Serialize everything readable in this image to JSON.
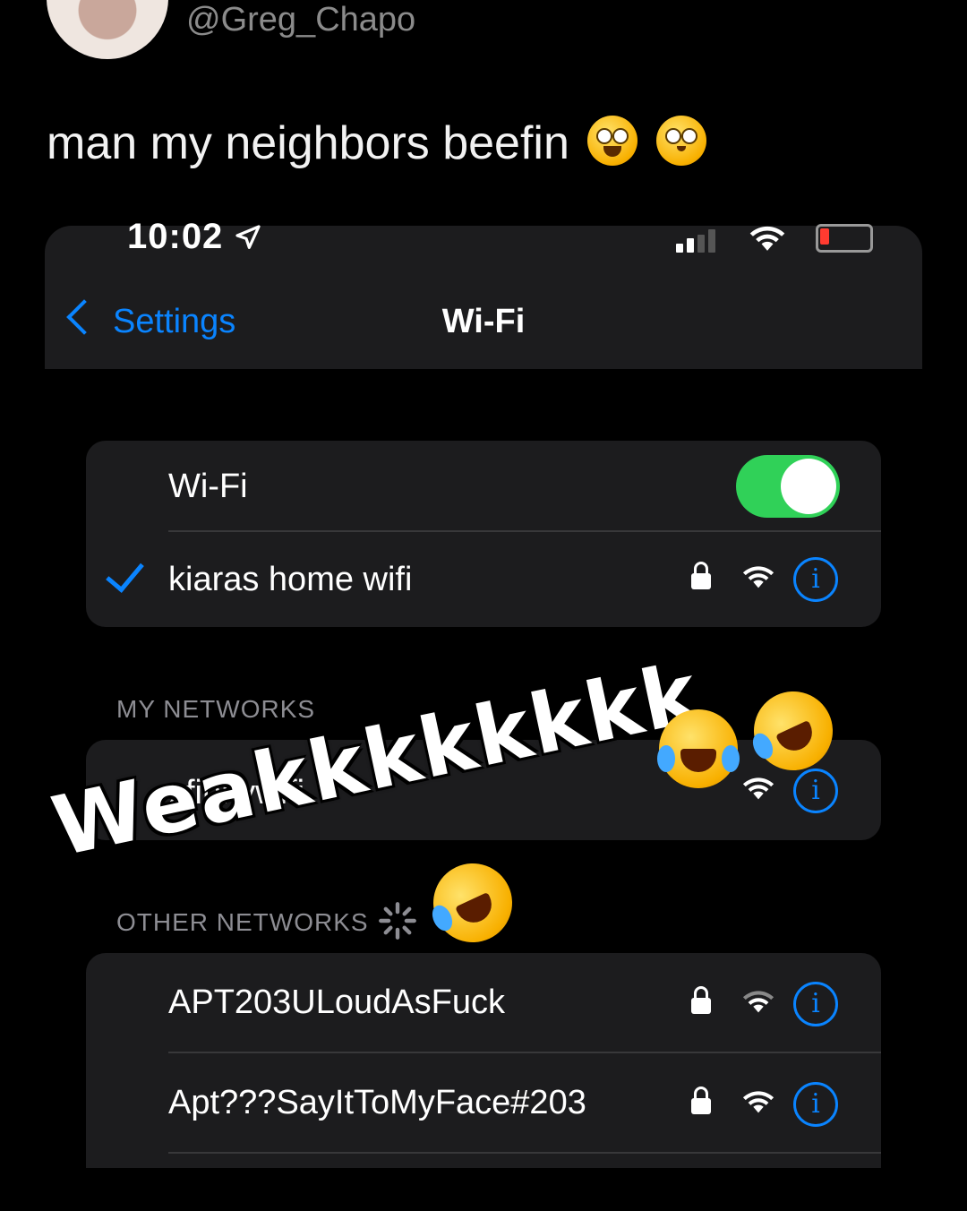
{
  "tweet": {
    "handle": "@Greg_Chapo",
    "text": "man my neighbors beefin",
    "emoji": [
      "rolling-on-floor-laughing-emoji",
      "flushed-face-emoji"
    ]
  },
  "status_bar": {
    "time": "10:02",
    "location_icon": "location-arrow-icon",
    "signal_icon": "cell-signal-icon",
    "wifi_icon": "wifi-icon",
    "battery_icon": "battery-charging-icon",
    "battery_color": "#ff3b30"
  },
  "nav": {
    "back_label": "Settings",
    "title": "Wi-Fi"
  },
  "wifi_toggle": {
    "label": "Wi-Fi",
    "on": true,
    "color": "#30d158"
  },
  "connected": {
    "name": "kiaras home wifi",
    "secured": true
  },
  "my_networks": {
    "header": "MY NETWORKS",
    "items": [
      {
        "name": "xfinitywifi",
        "secured": false
      }
    ]
  },
  "other_networks": {
    "header": "OTHER NETWORKS",
    "items": [
      {
        "name": "APT203ULoudAsFuck",
        "secured": true
      },
      {
        "name": "Apt???SayItToMyFace#203",
        "secured": true
      }
    ]
  },
  "overlay": {
    "sticker_text": "Weakkkkkkkk",
    "emoji": [
      "loudly-crying-emoji",
      "rolling-on-floor-laughing-emoji",
      "rolling-on-floor-laughing-emoji"
    ]
  },
  "colors": {
    "accent": "#0a84ff",
    "group_bg": "#1c1c1e",
    "secondary_text": "#8d8d93"
  }
}
